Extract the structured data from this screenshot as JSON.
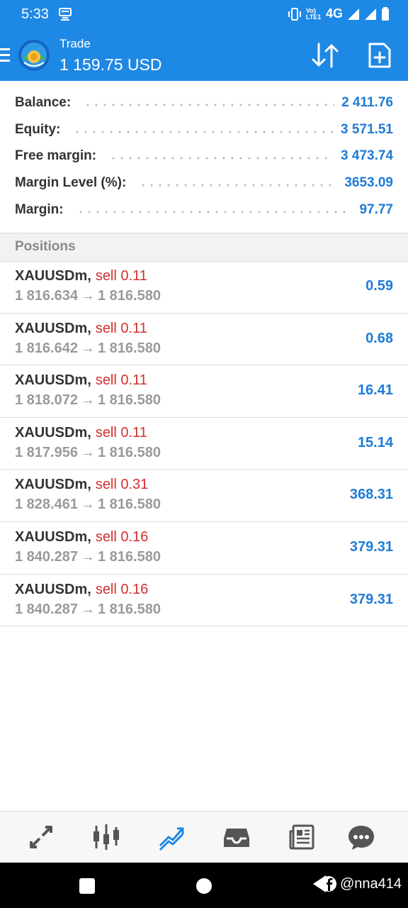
{
  "status_bar": {
    "time": "5:33",
    "network": "4G",
    "volte": "Vo) LTE1"
  },
  "app_bar": {
    "title": "Trade",
    "subtitle": "1 159.75 USD"
  },
  "summary": [
    {
      "label": "Balance:",
      "value": "2 411.76"
    },
    {
      "label": "Equity:",
      "value": "3 571.51"
    },
    {
      "label": "Free margin:",
      "value": "3 473.74"
    },
    {
      "label": "Margin Level (%):",
      "value": "3653.09"
    },
    {
      "label": "Margin:",
      "value": "97.77"
    }
  ],
  "positions_header": "Positions",
  "positions": [
    {
      "symbol": "XAUUSDm",
      "type": "sell 0.11",
      "open": "1 816.634",
      "current": "1 816.580",
      "profit": "0.59"
    },
    {
      "symbol": "XAUUSDm",
      "type": "sell 0.11",
      "open": "1 816.642",
      "current": "1 816.580",
      "profit": "0.68"
    },
    {
      "symbol": "XAUUSDm",
      "type": "sell 0.11",
      "open": "1 818.072",
      "current": "1 816.580",
      "profit": "16.41"
    },
    {
      "symbol": "XAUUSDm",
      "type": "sell 0.11",
      "open": "1 817.956",
      "current": "1 816.580",
      "profit": "15.14"
    },
    {
      "symbol": "XAUUSDm",
      "type": "sell 0.31",
      "open": "1 828.461",
      "current": "1 816.580",
      "profit": "368.31"
    },
    {
      "symbol": "XAUUSDm",
      "type": "sell 0.16",
      "open": "1 840.287",
      "current": "1 816.580",
      "profit": "379.31"
    },
    {
      "symbol": "XAUUSDm",
      "type": "sell 0.16",
      "open": "1 840.287",
      "current": "1 816.580",
      "profit": "379.31"
    }
  ],
  "bottom_nav": [
    {
      "icon": "quotes-icon",
      "active": false
    },
    {
      "icon": "chart-icon",
      "active": false
    },
    {
      "icon": "trade-icon",
      "active": true
    },
    {
      "icon": "history-icon",
      "active": false
    },
    {
      "icon": "news-icon",
      "active": false
    },
    {
      "icon": "messages-icon",
      "active": false
    }
  ],
  "watermark": "@nna414",
  "colors": {
    "accent": "#1e88e5",
    "value_blue": "#1e7bd6",
    "sell_red": "#d32f2f",
    "muted_gray": "#9a9a9a"
  }
}
